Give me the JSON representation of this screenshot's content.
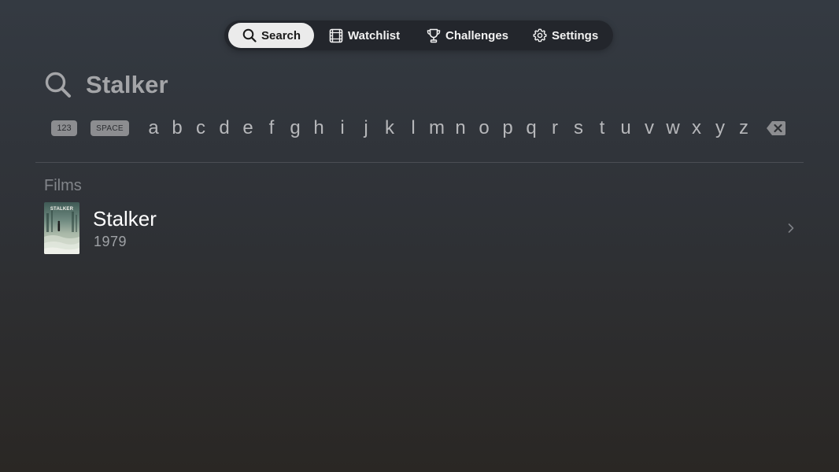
{
  "nav": {
    "tabs": [
      {
        "label": "Search",
        "icon": "search-icon",
        "active": true
      },
      {
        "label": "Watchlist",
        "icon": "film-strip-icon",
        "active": false
      },
      {
        "label": "Challenges",
        "icon": "trophy-icon",
        "active": false
      },
      {
        "label": "Settings",
        "icon": "gear-icon",
        "active": false
      }
    ]
  },
  "search": {
    "icon": "search-icon",
    "query": "Stalker"
  },
  "keyboard": {
    "numbers_label": "123",
    "space_label": "SPACE",
    "letters": [
      "a",
      "b",
      "c",
      "d",
      "e",
      "f",
      "g",
      "h",
      "i",
      "j",
      "k",
      "l",
      "m",
      "n",
      "o",
      "p",
      "q",
      "r",
      "s",
      "t",
      "u",
      "v",
      "w",
      "x",
      "y",
      "z"
    ],
    "delete_icon": "backspace-icon"
  },
  "results": {
    "section_title": "Films",
    "items": [
      {
        "title": "Stalker",
        "year": "1979",
        "poster_text": "STALKER",
        "chevron_icon": "chevron-right-icon"
      }
    ]
  },
  "colors": {
    "active_tab_bg": "#ebebeb",
    "nav_bg": "#22252a",
    "search_text": "#a4a5a8",
    "key_pill_bg": "#8c8d90"
  }
}
